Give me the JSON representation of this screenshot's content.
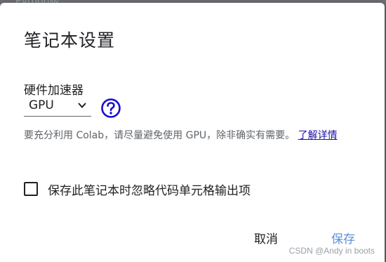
{
  "backdrop": {
    "partial_text": "Python版"
  },
  "dialog": {
    "title": "笔记本设置",
    "accelerator": {
      "label": "硬件加速器",
      "selected": "GPU",
      "help_icon": "question-circle-icon"
    },
    "note": {
      "text": "要充分利用 Colab，请尽量避免使用 GPU，除非确实有需要。",
      "link": "了解详情"
    },
    "omit_output": {
      "label": "保存此笔记本时忽略代码单元格输出项",
      "checked": false
    },
    "buttons": {
      "cancel": "取消",
      "save": "保存"
    }
  },
  "watermark": "CSDN @Andy in boots",
  "colors": {
    "help_icon": "#1a0dcc",
    "save_button": "#5b8fd8",
    "link": "#1a0dab"
  }
}
